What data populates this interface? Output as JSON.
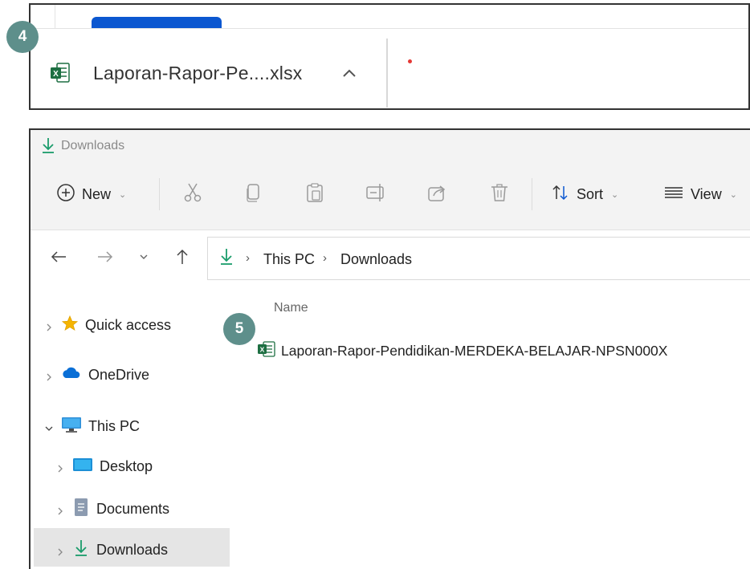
{
  "badges": {
    "step4": "4",
    "step5": "5"
  },
  "download_bar": {
    "file_label": "Laporan-Rapor-Pe....xlsx",
    "file_icon": "excel-file-icon",
    "expand_icon": "chevron-up-icon"
  },
  "explorer": {
    "title": "Downloads",
    "toolbar": {
      "new_label": "New",
      "sort_label": "Sort",
      "view_label": "View",
      "icons": [
        "cut-icon",
        "copy-icon",
        "paste-icon",
        "rename-icon",
        "share-icon",
        "delete-icon"
      ]
    },
    "breadcrumb": [
      "This PC",
      "Downloads"
    ],
    "column_header": "Name",
    "files": [
      {
        "name": "Laporan-Rapor-Pendidikan-MERDEKA-BELAJAR-NPSN000X",
        "icon": "excel-file-icon"
      }
    ],
    "sidebar": {
      "quick_access": "Quick access",
      "onedrive": "OneDrive",
      "this_pc": "This PC",
      "desktop": "Desktop",
      "documents": "Documents",
      "downloads": "Downloads"
    }
  },
  "colors": {
    "badge": "#5e8f8b",
    "download_green": "#1a9c6b",
    "excel_green": "#1d6f42",
    "tab_blue": "#0b57d0"
  }
}
